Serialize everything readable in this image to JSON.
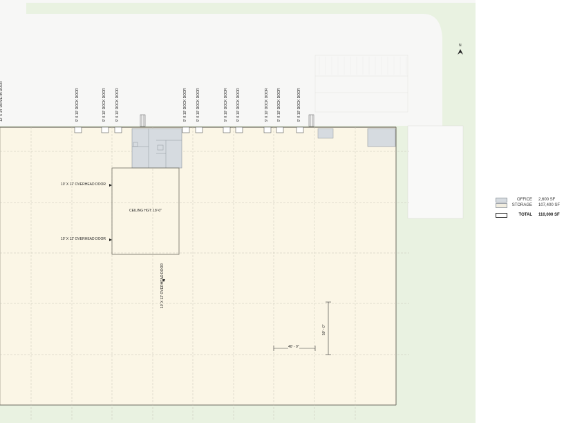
{
  "plan": {
    "north_label": "N",
    "ceiling_label": "CEILING HGT: 18'-0\"",
    "overhead_door_label": "10' X 12' OVERHEAD DOOR",
    "drive_in_door_label": "12' X 14' DRIVE-IN DOOR",
    "dock_door_label": "9' X 10' DOCK DOOR",
    "dimension_horizontal": "40' - 0\"",
    "dimension_vertical": "50' - 0\""
  },
  "legend": {
    "items": [
      {
        "name": "OFFICE",
        "value": "2,600 SF"
      },
      {
        "name": "STORAGE",
        "value": "107,400 SF"
      }
    ],
    "total": {
      "name": "TOTAL",
      "value": "110,000 SF"
    }
  },
  "colors": {
    "site_green": "#e9f2e1",
    "paving": "#f7f7f6",
    "building_fill": "#fbf6e6",
    "office_fill": "#d6dbe0",
    "grid_line": "#c7c3b4"
  }
}
